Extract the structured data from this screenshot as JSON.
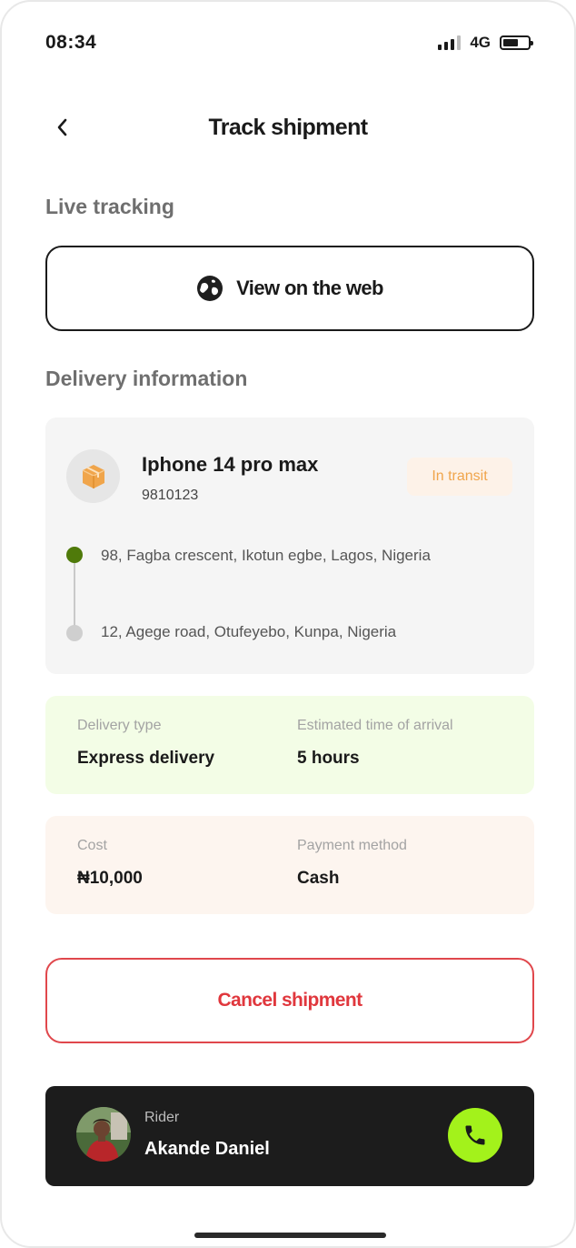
{
  "status_bar": {
    "time": "08:34",
    "network": "4G",
    "battery_level": 0.6,
    "signal_bars": 4,
    "signal_bars_active": 3
  },
  "header": {
    "title": "Track shipment"
  },
  "live_tracking": {
    "label": "Live tracking",
    "web_button_label": "View on the web"
  },
  "delivery_info": {
    "label": "Delivery information",
    "item_name": "Iphone 14 pro max",
    "item_code": "9810123",
    "status": "In transit",
    "from_address": "98, Fagba crescent, Ikotun egbe, Lagos, Nigeria",
    "to_address": "12, Agege road, Otufeyebo, Kunpa, Nigeria"
  },
  "delivery_details": {
    "type_label": "Delivery type",
    "type_value": "Express delivery",
    "eta_label": "Estimated time of arrival",
    "eta_value": "5 hours"
  },
  "payment": {
    "cost_label": "Cost",
    "cost_value": "₦10,000",
    "method_label": "Payment method",
    "method_value": "Cash"
  },
  "cancel_button_label": "Cancel shipment",
  "rider": {
    "role": "Rider",
    "name": "Akande Daniel"
  },
  "icons": {
    "back": "chevron-left-icon",
    "web": "globe-icon",
    "package": "package-icon",
    "call": "phone-icon"
  },
  "colors": {
    "accent_green": "#a3f21b",
    "status_orange": "#f0a54b",
    "cancel_red": "#e0373d",
    "origin_dot": "#4f7a0a",
    "rider_bg": "#1c1c1c"
  }
}
